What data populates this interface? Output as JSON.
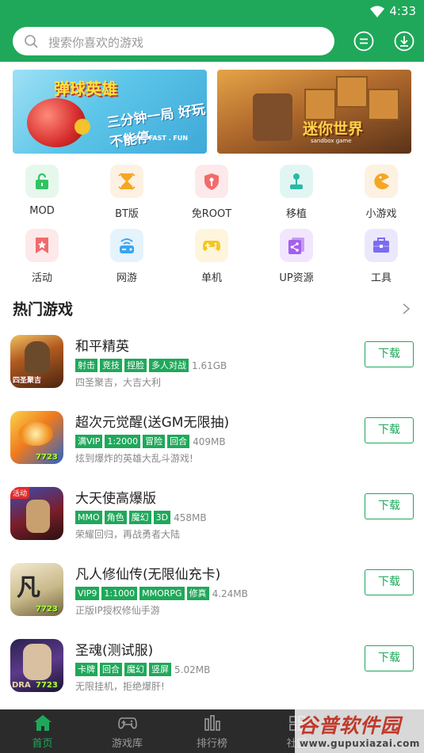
{
  "status_bar": {
    "time": "4:33"
  },
  "search": {
    "placeholder": "搜索你喜欢的游戏"
  },
  "banners": [
    {
      "title": "弹球英雄",
      "subtitle": "三分钟一局 好玩不能停",
      "tagline": "EASY . FAST . FUN"
    },
    {
      "title": "迷你世界",
      "tagline": "sandbox game"
    }
  ],
  "categories": [
    {
      "label": "MOD",
      "icon": "lock-icon",
      "color": "#2fc461",
      "bg": "#e6f8ec"
    },
    {
      "label": "BT版",
      "icon": "bt-hourglass-icon",
      "color": "#f5a623",
      "bg": "#fdf1e1"
    },
    {
      "label": "免ROOT",
      "icon": "shield-icon",
      "color": "#f26b6b",
      "bg": "#fde9e9"
    },
    {
      "label": "移植",
      "icon": "joystick-icon",
      "color": "#2ab9a8",
      "bg": "#e1f6f3"
    },
    {
      "label": "小游戏",
      "icon": "pacman-icon",
      "color": "#f5a623",
      "bg": "#fdf1e1"
    },
    {
      "label": "活动",
      "icon": "star-bookmark-icon",
      "color": "#f26b6b",
      "bg": "#fde9e9"
    },
    {
      "label": "网游",
      "icon": "online-game-icon",
      "color": "#3aa5f0",
      "bg": "#e5f3fd"
    },
    {
      "label": "单机",
      "icon": "gamepad-icon",
      "color": "#f5c623",
      "bg": "#fdf5dc"
    },
    {
      "label": "UP资源",
      "icon": "share-icon",
      "color": "#a55ef0",
      "bg": "#f1e6fd"
    },
    {
      "label": "工具",
      "icon": "toolbox-icon",
      "color": "#7b6cf0",
      "bg": "#ebe8fd"
    }
  ],
  "section": {
    "title": "热门游戏"
  },
  "games": [
    {
      "name": "和平精英",
      "tags": [
        "射击",
        "竞技",
        "捏脸",
        "多人对战"
      ],
      "size": "1.61GB",
      "desc": "四圣聚吉，大吉大利",
      "button": "下载",
      "icon_badge": "四圣聚吉",
      "corner": ""
    },
    {
      "name": "超次元觉醒(送GM无限抽)",
      "tags": [
        "满VIP",
        "1:2000",
        "冒险",
        "回合"
      ],
      "size": "409MB",
      "desc": "炫到爆炸的英雄大乱斗游戏!",
      "button": "下载",
      "icon_badge": "7723",
      "corner": ""
    },
    {
      "name": "大天使高爆版",
      "tags": [
        "MMO",
        "角色",
        "魔幻",
        "3D"
      ],
      "size": "458MB",
      "desc": "荣耀回归，再战勇者大陆",
      "button": "下载",
      "icon_badge": "",
      "corner": "活动"
    },
    {
      "name": "凡人修仙传(无限仙充卡)",
      "tags": [
        "VIP9",
        "1:1000",
        "MMORPG",
        "修真"
      ],
      "size": "4.24MB",
      "desc": "正版IP授权修仙手游",
      "button": "下载",
      "icon_badge": "7723",
      "corner": ""
    },
    {
      "name": "圣魂(测试服)",
      "tags": [
        "卡牌",
        "回合",
        "魔幻",
        "竖屏"
      ],
      "size": "5.02MB",
      "desc": "无限挂机，拒绝爆肝!",
      "button": "下载",
      "icon_badge": "7723",
      "corner": ""
    }
  ],
  "tabs": [
    {
      "label": "首页",
      "icon": "home-icon",
      "active": true
    },
    {
      "label": "游戏库",
      "icon": "gamepad-icon",
      "active": false
    },
    {
      "label": "排行榜",
      "icon": "ranking-icon",
      "active": false
    },
    {
      "label": "社区",
      "icon": "community-icon",
      "active": false
    }
  ],
  "watermark": {
    "title": "谷普软件园",
    "url": "www.gupuxiazai.com"
  },
  "colors": {
    "brand_green": "#1fa85a",
    "tabbar_bg": "#2b2b2b"
  }
}
